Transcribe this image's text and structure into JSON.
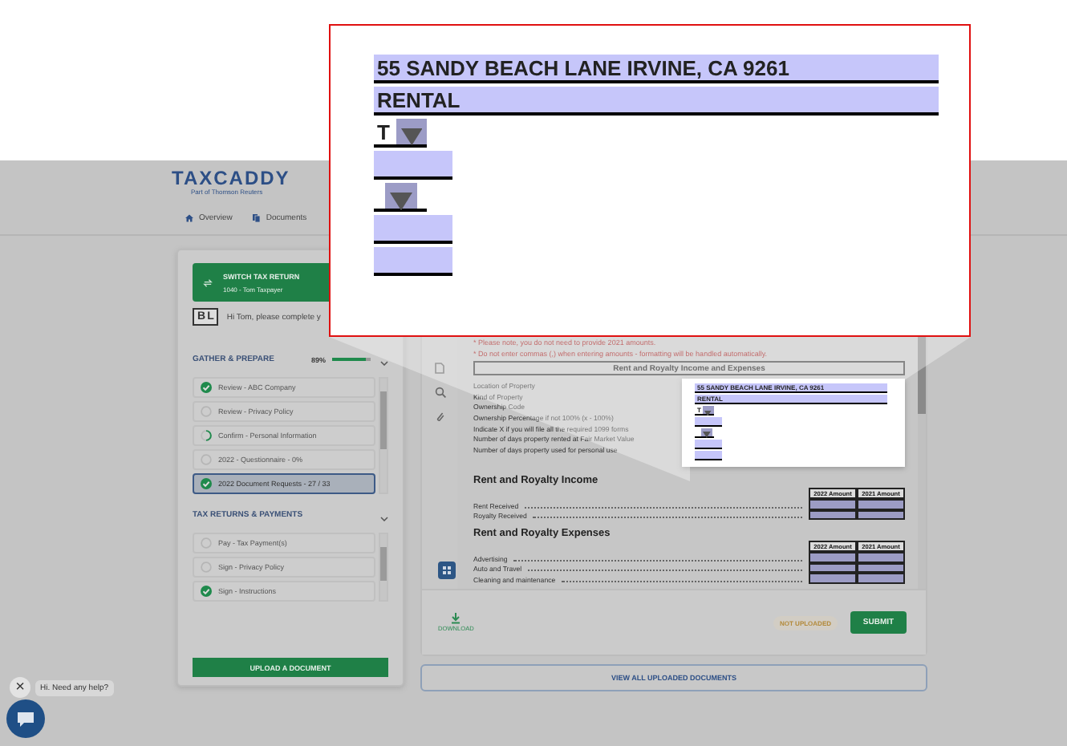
{
  "header": {
    "logo": "TAXCADDY",
    "tagline": "Part of Thomson Reuters",
    "nav": [
      {
        "label": "Overview"
      },
      {
        "label": "Documents"
      }
    ]
  },
  "left_panel": {
    "switch_button": {
      "title": "SWITCH TAX RETURN",
      "subtitle": "1040 - Tom Taxpayer"
    },
    "avatar_initials": [
      "B",
      "L"
    ],
    "greeting": "Hi Tom, please complete y",
    "sections": [
      {
        "title": "GATHER & PREPARE",
        "percent": "89%",
        "level": 0.89,
        "expanded": true,
        "items": [
          {
            "label": "Review - ABC Company",
            "kind": "done",
            "selected": false
          },
          {
            "label": "Review - Privacy Policy",
            "kind": "todo",
            "selected": false
          },
          {
            "label": "Confirm - Personal Information",
            "kind": "partial",
            "selected": false
          },
          {
            "label": "2022 - Questionnaire - 0%",
            "kind": "todo",
            "selected": false
          },
          {
            "label": "2022 Document Requests - 27 / 33",
            "kind": "done",
            "selected": true
          }
        ]
      },
      {
        "title": "TAX RETURNS & PAYMENTS",
        "expanded": true,
        "items": [
          {
            "label": "Pay - Tax Payment(s)",
            "kind": "todo",
            "selected": false
          },
          {
            "label": "Sign - Privacy Policy",
            "kind": "todo",
            "selected": false
          },
          {
            "label": "Sign - Instructions",
            "kind": "done",
            "selected": false
          }
        ]
      }
    ],
    "upload_button": "UPLOAD A DOCUMENT"
  },
  "viewer": {
    "notes": [
      "* Please note, you do not need to provide 2021 amounts.",
      "* Do not enter commas (,) when entering amounts - formatting will be handled automatically."
    ],
    "form_title": "Rent and Royalty Income and Expenses",
    "property_labels": [
      "Location of Property",
      "Kind of Property",
      "Ownership Code",
      "Ownership Percentage if not 100% (x - 100%)",
      "Indicate X if you will file all the required 1099 forms",
      "Number of days property rented at Fair Market Value",
      "Number of days property used for personal use"
    ],
    "property_fields": [
      {
        "kind": "text",
        "value": "55 SANDY BEACH LANE IRVINE, CA 9261"
      },
      {
        "kind": "text",
        "value": "RENTAL"
      },
      {
        "kind": "dropdown",
        "value": "T"
      },
      {
        "kind": "short"
      },
      {
        "kind": "dropdown"
      },
      {
        "kind": "short"
      },
      {
        "kind": "short"
      }
    ],
    "income": {
      "title": "Rent and Royalty Income",
      "columns": [
        "2022 Amount",
        "2021 Amount"
      ],
      "rows": [
        "Rent Received",
        "Royalty Received"
      ]
    },
    "expenses": {
      "title": "Rent and Royalty Expenses",
      "columns": [
        "2022 Amount",
        "2021 Amount"
      ],
      "rows": [
        "Advertising",
        "Auto and Travel",
        "Cleaning and maintenance"
      ]
    },
    "download": "DOWNLOAD",
    "status_badge": "NOT UPLOADED",
    "submit": "SUBMIT"
  },
  "view_all_button": "VIEW ALL UPLOADED DOCUMENTS",
  "chat": {
    "close": "×",
    "message": "Hi. Need any help?"
  },
  "callout": {
    "fields": [
      {
        "kind": "text",
        "value": "55 SANDY BEACH LANE IRVINE, CA 9261"
      },
      {
        "kind": "text",
        "value": "RENTAL"
      },
      {
        "kind": "dropdown",
        "value": "T"
      },
      {
        "kind": "short"
      },
      {
        "kind": "dropdown"
      },
      {
        "kind": "short"
      },
      {
        "kind": "short"
      }
    ]
  }
}
